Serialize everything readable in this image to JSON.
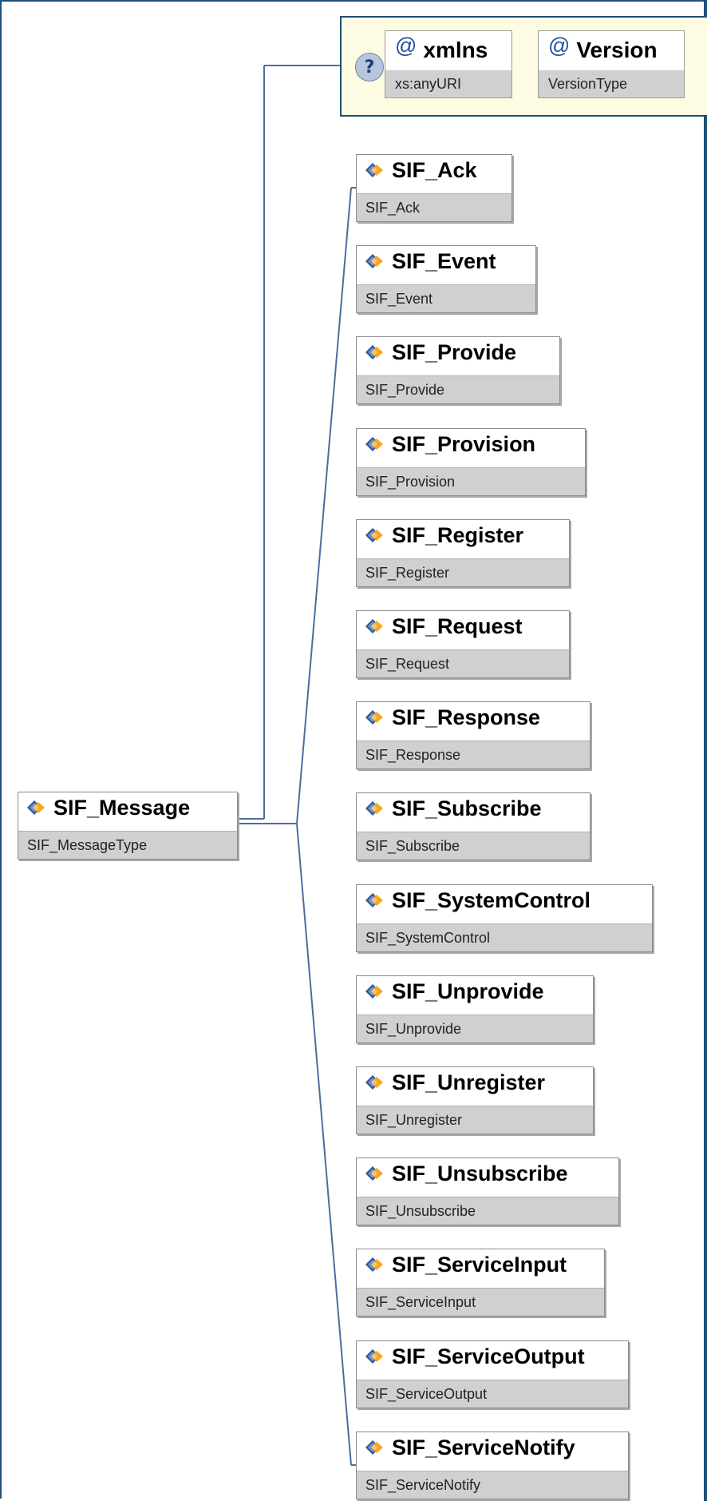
{
  "root": {
    "name": "SIF_Message",
    "type": "SIF_MessageType"
  },
  "attributes": [
    {
      "name": "xmlns",
      "type": "xs:anyURI"
    },
    {
      "name": "Version",
      "type": "VersionType"
    }
  ],
  "attribute_marker": "@",
  "help_icon": "?",
  "children": [
    {
      "name": "SIF_Ack",
      "type": "SIF_Ack"
    },
    {
      "name": "SIF_Event",
      "type": "SIF_Event"
    },
    {
      "name": "SIF_Provide",
      "type": "SIF_Provide"
    },
    {
      "name": "SIF_Provision",
      "type": "SIF_Provision"
    },
    {
      "name": "SIF_Register",
      "type": "SIF_Register"
    },
    {
      "name": "SIF_Request",
      "type": "SIF_Request"
    },
    {
      "name": "SIF_Response",
      "type": "SIF_Response"
    },
    {
      "name": "SIF_Subscribe",
      "type": "SIF_Subscribe"
    },
    {
      "name": "SIF_SystemControl",
      "type": "SIF_SystemControl"
    },
    {
      "name": "SIF_Unprovide",
      "type": "SIF_Unprovide"
    },
    {
      "name": "SIF_Unregister",
      "type": "SIF_Unregister"
    },
    {
      "name": "SIF_Unsubscribe",
      "type": "SIF_Unsubscribe"
    },
    {
      "name": "SIF_ServiceInput",
      "type": "SIF_ServiceInput"
    },
    {
      "name": "SIF_ServiceOutput",
      "type": "SIF_ServiceOutput"
    },
    {
      "name": "SIF_ServiceNotify",
      "type": "SIF_ServiceNotify"
    }
  ],
  "colors": {
    "frame": "#1f4e79",
    "connector": "#4a6f9c",
    "attribute_group_bg": "#fefbe3",
    "type_bar": "#d0d0d0",
    "icon_blue": "#2c5aa0",
    "icon_orange": "#f5a623"
  }
}
